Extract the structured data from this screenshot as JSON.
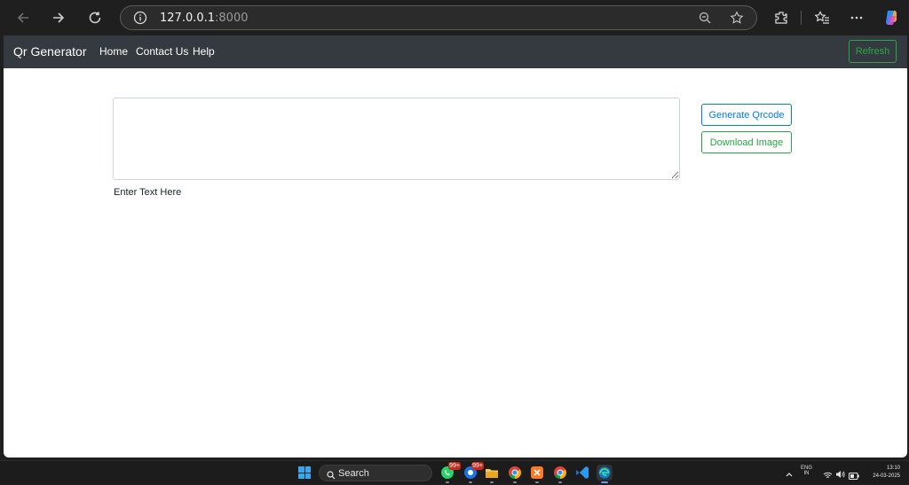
{
  "browser": {
    "address": {
      "host": "127.0.0.1",
      "port": ":8000"
    }
  },
  "navbar": {
    "brand": "Qr Generator",
    "links": [
      "Home",
      "Contact Us",
      "Help"
    ],
    "refresh_label": "Refresh"
  },
  "main": {
    "textarea_value": "",
    "input_label": "Enter Text Here",
    "generate_label": "Generate Qrcode",
    "download_label": "Download Image"
  },
  "taskbar": {
    "search_label": "Search",
    "badge_whatsapp": "99+",
    "badge_browser": "99+",
    "lang_top": "ENG",
    "lang_bottom": "IN",
    "time": "13:10",
    "date": "24-03-2025"
  },
  "colors": {
    "navbar_bg": "#343a40",
    "primary": "#007bff",
    "success": "#28a745"
  }
}
